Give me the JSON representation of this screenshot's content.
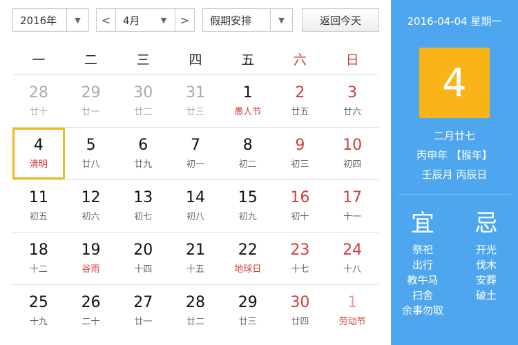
{
  "toolbar": {
    "year": "2016年",
    "month": "4月",
    "holiday": "假期安排",
    "today": "返回今天",
    "prev_glyph": "<",
    "next_glyph": ">",
    "caret_glyph": "▼"
  },
  "weekdays": [
    "一",
    "二",
    "三",
    "四",
    "五",
    "六",
    "日"
  ],
  "weeks": [
    [
      {
        "day": "28",
        "sub": "廿十",
        "other": true,
        "we": false,
        "fest": false
      },
      {
        "day": "29",
        "sub": "廿一",
        "other": true,
        "we": false,
        "fest": false
      },
      {
        "day": "30",
        "sub": "廿二",
        "other": true,
        "we": false,
        "fest": false
      },
      {
        "day": "31",
        "sub": "廿三",
        "other": true,
        "we": false,
        "fest": false
      },
      {
        "day": "1",
        "sub": "愚人节",
        "other": false,
        "we": false,
        "fest": true
      },
      {
        "day": "2",
        "sub": "廿五",
        "other": false,
        "we": true,
        "fest": false
      },
      {
        "day": "3",
        "sub": "廿六",
        "other": false,
        "we": true,
        "fest": false
      }
    ],
    [
      {
        "day": "4",
        "sub": "清明",
        "other": false,
        "we": false,
        "fest": true,
        "sel": true
      },
      {
        "day": "5",
        "sub": "廿八",
        "other": false,
        "we": false,
        "fest": false
      },
      {
        "day": "6",
        "sub": "廿九",
        "other": false,
        "we": false,
        "fest": false
      },
      {
        "day": "7",
        "sub": "初一",
        "other": false,
        "we": false,
        "fest": false
      },
      {
        "day": "8",
        "sub": "初二",
        "other": false,
        "we": false,
        "fest": false
      },
      {
        "day": "9",
        "sub": "初三",
        "other": false,
        "we": true,
        "fest": false
      },
      {
        "day": "10",
        "sub": "初四",
        "other": false,
        "we": true,
        "fest": false
      }
    ],
    [
      {
        "day": "11",
        "sub": "初五",
        "other": false,
        "we": false,
        "fest": false
      },
      {
        "day": "12",
        "sub": "初六",
        "other": false,
        "we": false,
        "fest": false
      },
      {
        "day": "13",
        "sub": "初七",
        "other": false,
        "we": false,
        "fest": false
      },
      {
        "day": "14",
        "sub": "初八",
        "other": false,
        "we": false,
        "fest": false
      },
      {
        "day": "15",
        "sub": "初九",
        "other": false,
        "we": false,
        "fest": false
      },
      {
        "day": "16",
        "sub": "初十",
        "other": false,
        "we": true,
        "fest": false
      },
      {
        "day": "17",
        "sub": "十一",
        "other": false,
        "we": true,
        "fest": false
      }
    ],
    [
      {
        "day": "18",
        "sub": "十二",
        "other": false,
        "we": false,
        "fest": false
      },
      {
        "day": "19",
        "sub": "谷雨",
        "other": false,
        "we": false,
        "fest": true
      },
      {
        "day": "20",
        "sub": "十四",
        "other": false,
        "we": false,
        "fest": false
      },
      {
        "day": "21",
        "sub": "十五",
        "other": false,
        "we": false,
        "fest": false
      },
      {
        "day": "22",
        "sub": "地球日",
        "other": false,
        "we": false,
        "fest": true
      },
      {
        "day": "23",
        "sub": "十七",
        "other": false,
        "we": true,
        "fest": false
      },
      {
        "day": "24",
        "sub": "十八",
        "other": false,
        "we": true,
        "fest": false
      }
    ],
    [
      {
        "day": "25",
        "sub": "十九",
        "other": false,
        "we": false,
        "fest": false
      },
      {
        "day": "26",
        "sub": "二十",
        "other": false,
        "we": false,
        "fest": false
      },
      {
        "day": "27",
        "sub": "廿一",
        "other": false,
        "we": false,
        "fest": false
      },
      {
        "day": "28",
        "sub": "廿二",
        "other": false,
        "we": false,
        "fest": false
      },
      {
        "day": "29",
        "sub": "廿三",
        "other": false,
        "we": false,
        "fest": false
      },
      {
        "day": "30",
        "sub": "廿四",
        "other": false,
        "we": true,
        "fest": false
      },
      {
        "day": "1",
        "sub": "劳动节",
        "other": true,
        "we": true,
        "fest": true
      }
    ]
  ],
  "side": {
    "date": "2016-04-04 星期一",
    "big_day": "4",
    "lunar": "二月廿七",
    "ganzhi_year": "丙申年 【猴年】",
    "ganzhi_md": "壬辰月 丙辰日",
    "yi_title": "宜",
    "ji_title": "忌",
    "yi": [
      "祭祀",
      "出行",
      "教牛马",
      "扫舍",
      "余事勿取"
    ],
    "ji": [
      "开光",
      "伐木",
      "安葬",
      "破土"
    ]
  },
  "colors": {
    "accent": "#4ea7ee",
    "highlight": "#f8b418",
    "weekend": "#d23b3b"
  }
}
